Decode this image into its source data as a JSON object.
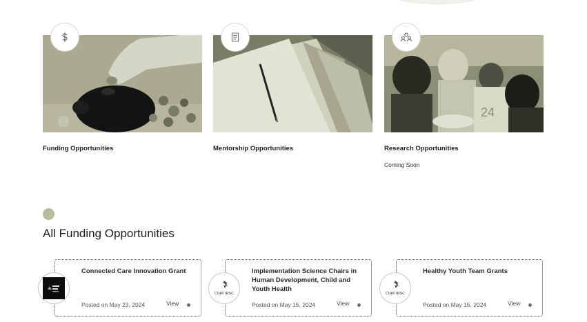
{
  "categories": [
    {
      "title": "Funding Opportunities",
      "subtitle": "",
      "icon": "dollar-icon"
    },
    {
      "title": "Mentorship Opportunities",
      "subtitle": "",
      "icon": "document-icon"
    },
    {
      "title": "Research Opportunities",
      "subtitle": "Coming Soon",
      "icon": "people-icon"
    }
  ],
  "section": {
    "title": "All Funding Opportunities"
  },
  "grants": [
    {
      "title": "Connected Care Innovation Grant",
      "posted": "Posted on May 23, 2024",
      "view_label": "View",
      "logo": "dark-square-logo"
    },
    {
      "title": "Implementation Science Chairs in Human Development, Child and Youth Health",
      "posted": "Posted on May 15, 2024",
      "view_label": "View",
      "logo": "cihr-irsc-logo"
    },
    {
      "title": "Healthy Youth Team Grants",
      "posted": "Posted on May 15, 2024",
      "view_label": "View",
      "logo": "cihr-irsc-logo"
    }
  ],
  "logo_text": {
    "cihr": "CIHR IRSC"
  },
  "colors": {
    "accent_olive": "#b9bc9c",
    "photo_tint": "#a7a88d"
  }
}
